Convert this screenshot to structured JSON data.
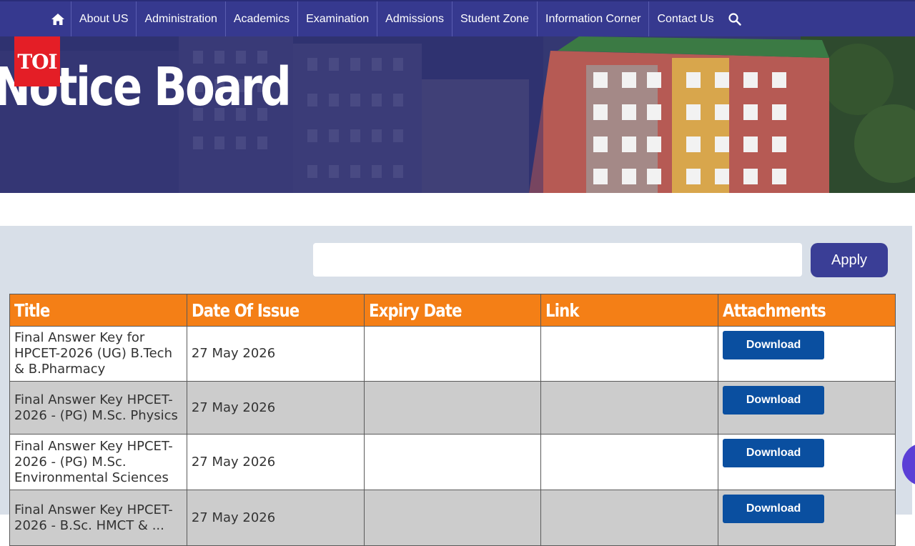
{
  "nav": {
    "home_icon": "home-icon",
    "items": [
      "About US",
      "Administration",
      "Academics",
      "Examination",
      "Admissions",
      "Student Zone",
      "Information Corner",
      "Contact Us"
    ],
    "search_icon": "search-icon"
  },
  "hero": {
    "title": "Notice Board",
    "logo_text": "TOI"
  },
  "filter": {
    "search_value": "",
    "apply_label": "Apply"
  },
  "table": {
    "headers": [
      "Title",
      "Date Of Issue",
      "Expiry Date",
      "Link",
      "Attachments"
    ],
    "rows": [
      {
        "title": "Final Answer Key for HPCET-2026 (UG) B.Tech & B.Pharmacy",
        "date": "27 May 2026",
        "expiry": "",
        "link": "",
        "attachment": "Download"
      },
      {
        "title": "Final Answer Key HPCET-2026 - (PG) M.Sc. Physics",
        "date": "27 May 2026",
        "expiry": "",
        "link": "",
        "attachment": "Download"
      },
      {
        "title": "Final Answer Key HPCET-2026 - (PG) M.Sc. Environmental Sciences",
        "date": "27 May 2026",
        "expiry": "",
        "link": "",
        "attachment": "Download"
      },
      {
        "title": "Final Answer Key HPCET-2026 - B.Sc. HMCT & ...",
        "date": "27 May 2026",
        "expiry": "",
        "link": "",
        "attachment": "Download"
      }
    ]
  },
  "colors": {
    "nav_bg": "#36398f",
    "header_orange": "#f47f16",
    "download_blue": "#0a4fa0",
    "apply_bg": "#3a3e96",
    "logo_red": "#e41e26"
  }
}
